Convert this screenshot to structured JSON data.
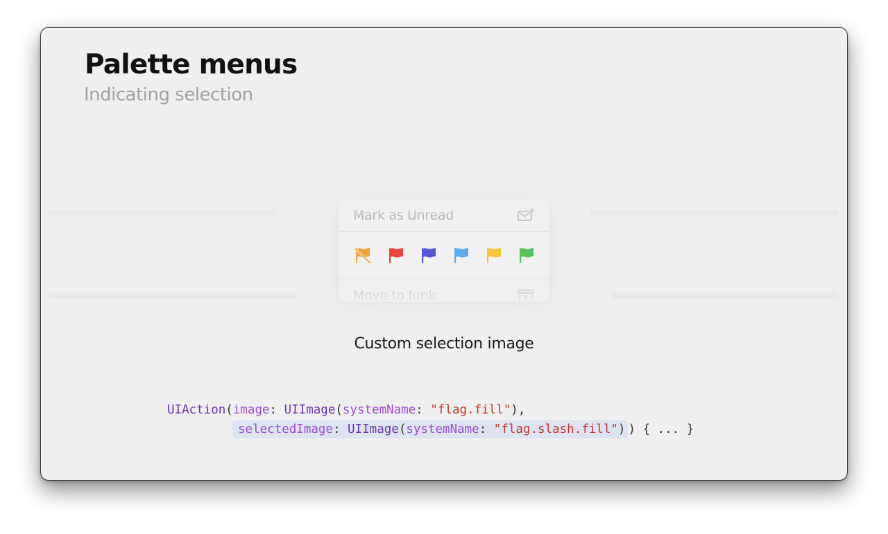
{
  "slide": {
    "title": "Palette menus",
    "subtitle": "Indicating selection",
    "caption": "Custom selection image"
  },
  "menu": {
    "top_item": {
      "label": "Mark as Unread",
      "icon": "envelope-badge-icon"
    },
    "bottom_item": {
      "label": "Move to Junk",
      "icon": "junk-bin-icon"
    },
    "flags": [
      {
        "name": "flag-slash",
        "color": "#f2a33a",
        "icon": "flag-slash-icon"
      },
      {
        "name": "flag-red",
        "color": "#e9453a",
        "icon": "flag-icon"
      },
      {
        "name": "flag-indigo",
        "color": "#5456d6",
        "icon": "flag-icon"
      },
      {
        "name": "flag-cyan",
        "color": "#5aaef0",
        "icon": "flag-icon"
      },
      {
        "name": "flag-yellow",
        "color": "#f5c53b",
        "icon": "flag-icon"
      },
      {
        "name": "flag-green",
        "color": "#5bc15c",
        "icon": "flag-icon"
      }
    ]
  },
  "code": {
    "line1": {
      "t1": "UIAction",
      "t2": "(",
      "t3": "image",
      "t4": ": ",
      "t5": "UIImage",
      "t6": "(",
      "t7": "systemName",
      "t8": ": ",
      "t9": "\"flag.fill\"",
      "t10": "),"
    },
    "line2": {
      "t1": "selectedImage",
      "t2": ": ",
      "t3": "UIImage",
      "t4": "(",
      "t5": "systemName",
      "t6": ": ",
      "t7": "\"flag.slash.fill\"",
      "t8": ")",
      "t9": ") { ... }"
    }
  },
  "colors": {
    "slide_bg": "#efefef",
    "highlight": "#dde3f1",
    "code_type": "#6c36a9",
    "code_param": "#9b4fd0",
    "code_string": "#c0392b"
  }
}
